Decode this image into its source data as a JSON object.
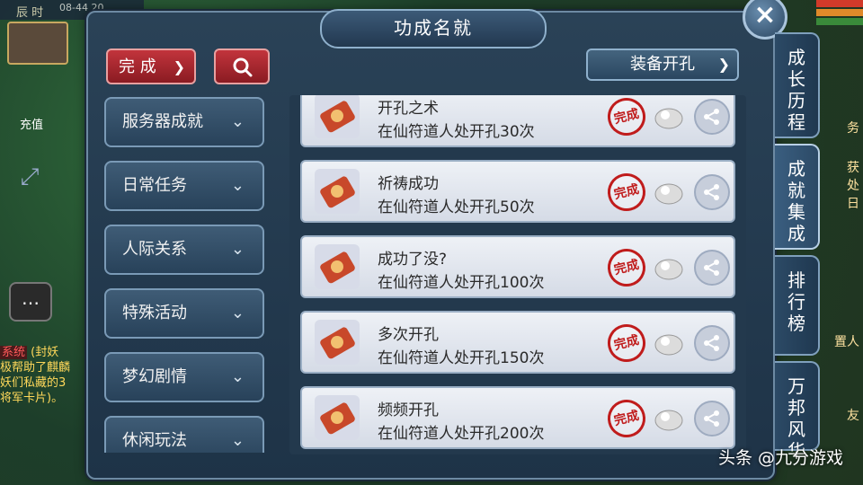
{
  "background": {
    "clock_label": "辰 时",
    "time_text": "08-44 20",
    "charge_label": "充值",
    "sys_tag": "系统",
    "sys_lines": [
      "(封妖",
      "极帮助了麒麟",
      "妖们私藏的3",
      "将军卡片)。"
    ],
    "right_texts": [
      "务",
      "获",
      "处",
      "日",
      "置人",
      "友"
    ]
  },
  "panel": {
    "title": "功成名就",
    "close_icon": "close-icon"
  },
  "toolbar": {
    "filter_label": "完 成",
    "search_icon": "search-icon",
    "equip_label": "装备开孔"
  },
  "categories": [
    {
      "label": "服务器成就"
    },
    {
      "label": "日常任务"
    },
    {
      "label": "人际关系"
    },
    {
      "label": "特殊活动"
    },
    {
      "label": "梦幻剧情"
    },
    {
      "label": "休闲玩法"
    }
  ],
  "achievements": [
    {
      "name": "开孔之术",
      "desc": "在仙符道人处开孔30次",
      "status": "完成"
    },
    {
      "name": "祈祷成功",
      "desc": "在仙符道人处开孔50次",
      "status": "完成"
    },
    {
      "name": "成功了没?",
      "desc": "在仙符道人处开孔100次",
      "status": "完成"
    },
    {
      "name": "多次开孔",
      "desc": "在仙符道人处开孔150次",
      "status": "完成"
    },
    {
      "name": "频频开孔",
      "desc": "在仙符道人处开孔200次",
      "status": "完成"
    }
  ],
  "side_tabs": [
    {
      "label": "成长历程"
    },
    {
      "label": "成就集成"
    },
    {
      "label": "排行榜"
    },
    {
      "label": "万邦风华"
    }
  ],
  "watermark": "头条 @九分游戏",
  "colors": {
    "accent_red": "#c2343c",
    "panel_bg": "#2a4257",
    "stamp_red": "#c01c1c"
  }
}
